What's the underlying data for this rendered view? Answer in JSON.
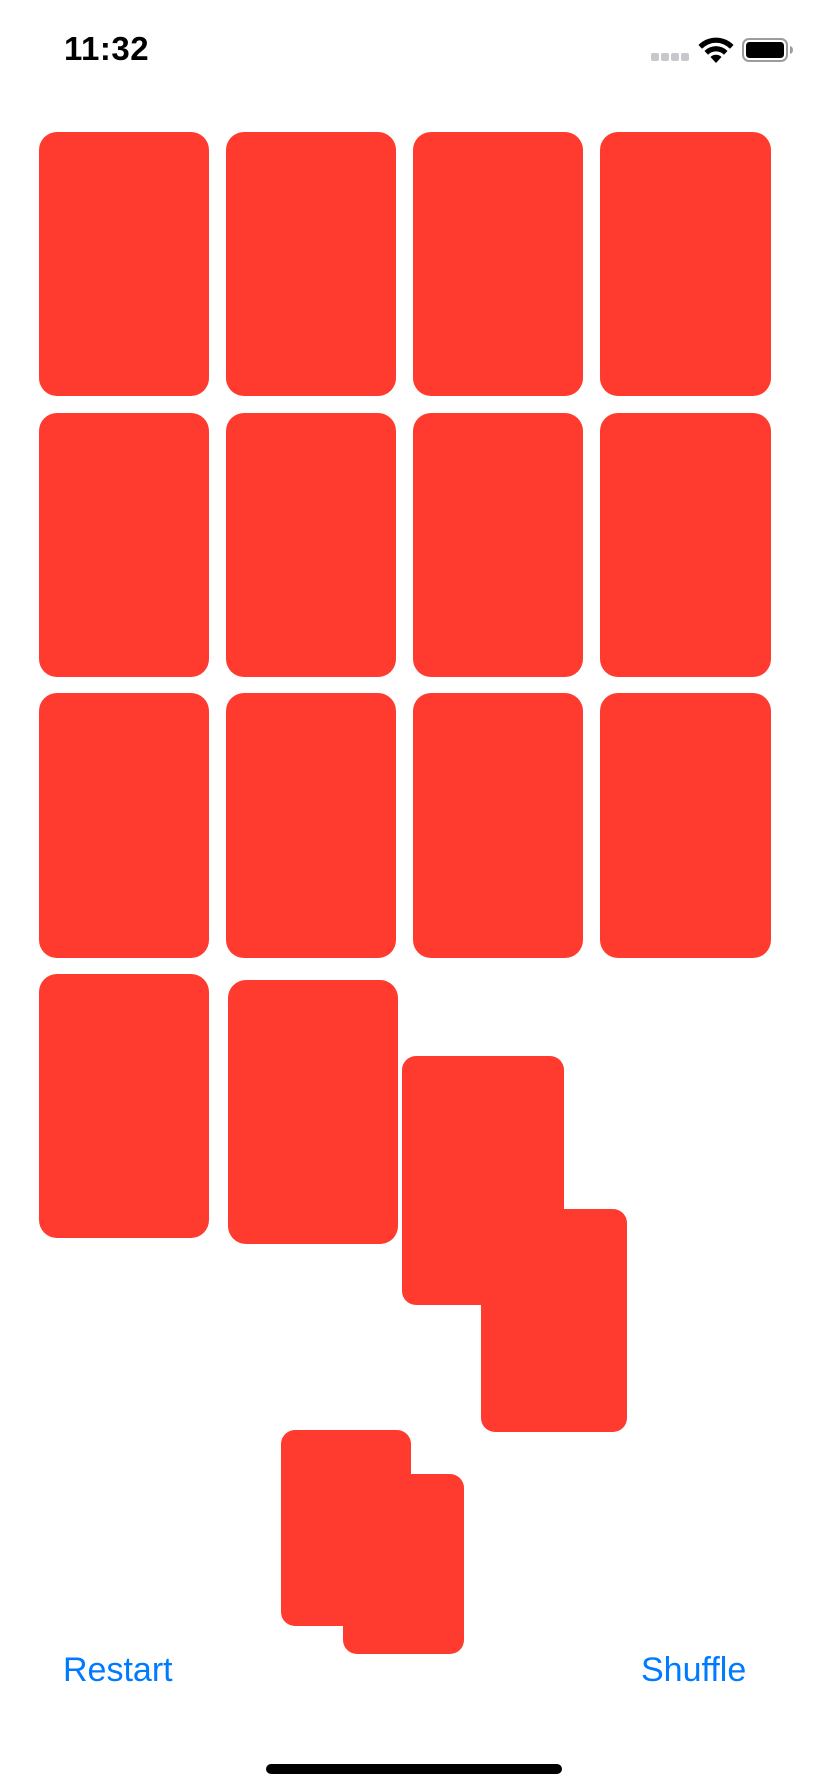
{
  "status_bar": {
    "time": "11:32",
    "signal_icon": "cellular-signal-icon",
    "wifi_icon": "wifi-icon",
    "battery_icon": "battery-icon"
  },
  "cards": {
    "face_color": "#ff3b30",
    "grid_count": 14,
    "dealt_count": 4,
    "face_up": false
  },
  "toolbar": {
    "restart_label": "Restart",
    "shuffle_label": "Shuffle",
    "button_color": "#007aff"
  }
}
